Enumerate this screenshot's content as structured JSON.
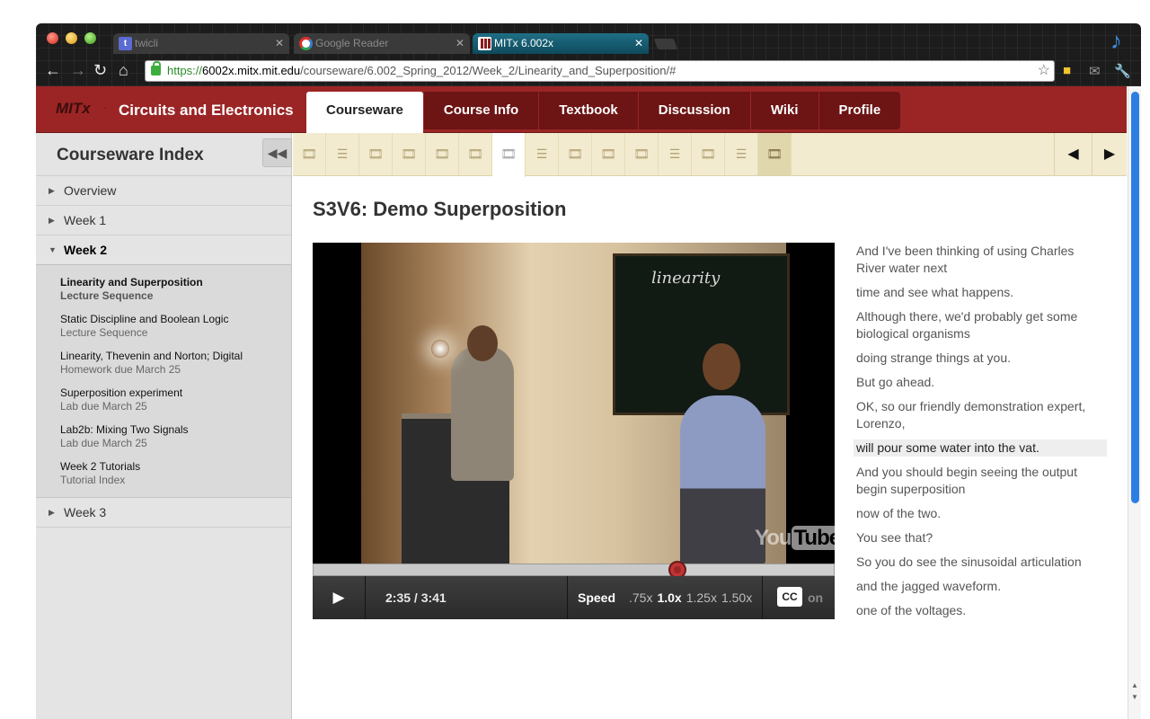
{
  "browser": {
    "tabs": [
      {
        "label": "twicli",
        "active": false
      },
      {
        "label": "Google Reader",
        "active": false
      },
      {
        "label": "MITx 6.002x",
        "active": true
      }
    ],
    "url_scheme": "https://",
    "url_host": "6002x.mitx.mit.edu",
    "url_path": "/courseware/6.002_Spring_2012/Week_2/Linearity_and_Superposition/#"
  },
  "header": {
    "logo": "MITx",
    "course_title": "Circuits and Electronics",
    "nav": [
      "Courseware",
      "Course Info",
      "Textbook",
      "Discussion",
      "Wiki",
      "Profile"
    ],
    "active_nav": "Courseware"
  },
  "sidebar": {
    "title": "Courseware Index",
    "chapters": [
      {
        "label": "Overview",
        "open": false
      },
      {
        "label": "Week 1",
        "open": false
      },
      {
        "label": "Week 2",
        "open": true
      },
      {
        "label": "Week 3",
        "open": false
      }
    ],
    "week2_sequences": [
      {
        "title": "Linearity and Superposition",
        "subtitle": "Lecture Sequence",
        "active": true
      },
      {
        "title": "Static Discipline and Boolean Logic",
        "subtitle": "Lecture Sequence",
        "active": false
      },
      {
        "title": "Linearity, Thevenin and Norton; Digital",
        "subtitle": "Homework due March 25",
        "active": false
      },
      {
        "title": "Superposition experiment",
        "subtitle": "Lab due March 25",
        "active": false
      },
      {
        "title": "Lab2b: Mixing Two Signals",
        "subtitle": "Lab due March 25",
        "active": false
      },
      {
        "title": "Week 2 Tutorials",
        "subtitle": "Tutorial Index",
        "active": false
      }
    ]
  },
  "sequence_nav": {
    "items": [
      "video",
      "list",
      "video",
      "video",
      "video",
      "video",
      "video",
      "list",
      "video",
      "video",
      "video",
      "list",
      "video",
      "list",
      "video"
    ],
    "active_index": 6
  },
  "unit": {
    "title": "S3V6: Demo Superposition"
  },
  "video": {
    "board_text": "linearity",
    "youtube": "You",
    "youtube2": "Tube",
    "time": "2:35 / 3:41",
    "progress": 0.7,
    "speed_label": "Speed",
    "speeds": [
      ".75x",
      "1.0x",
      "1.25x",
      "1.50x"
    ],
    "active_speed": "1.0x",
    "cc": "CC",
    "cc_state": "on"
  },
  "transcript": [
    "And I've been thinking of using Charles River water next",
    "time and see what happens.",
    "Although there, we'd probably get some biological organisms",
    "doing strange things at you.",
    "But go ahead.",
    "OK, so our friendly demonstration expert, Lorenzo,",
    "will pour some water into the vat.",
    "And you should begin seeing the output begin superposition",
    "now of the two.",
    "You see that?",
    "So you do see the sinusoidal articulation",
    "and the jagged waveform.",
    "one of the voltages."
  ],
  "transcript_current": 6,
  "colors": {
    "brand": "#9b2525",
    "seq_bar": "#f3ebcf",
    "scroll_thumb": "#2d7ee3"
  }
}
